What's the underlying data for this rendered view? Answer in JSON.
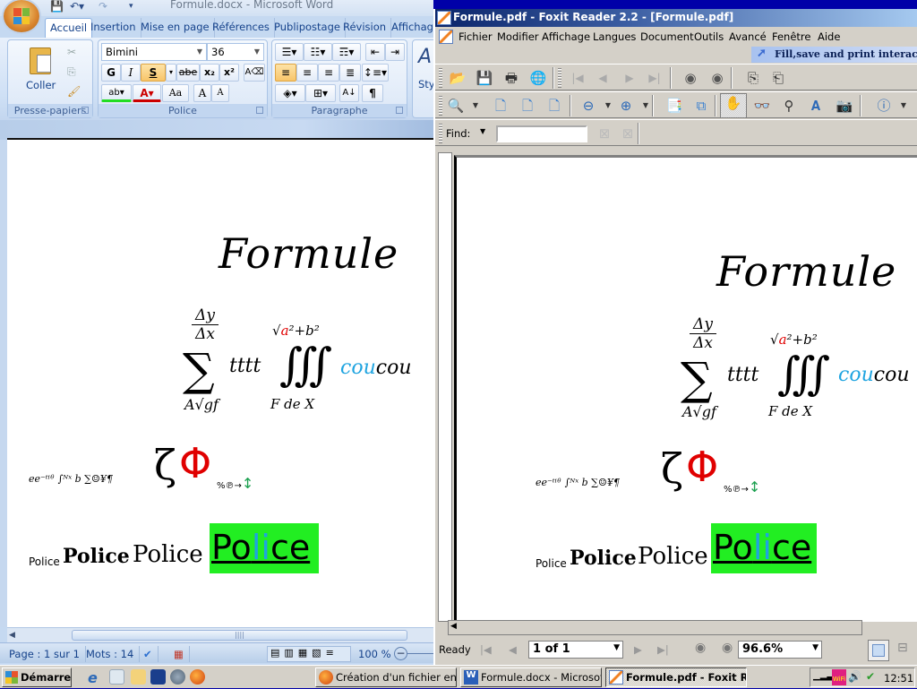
{
  "word": {
    "title": "Formule.docx - Microsoft Word",
    "quick_access": {
      "save": "save-icon",
      "undo": "undo-icon",
      "redo": "redo-icon",
      "customize": "customize-icon"
    },
    "tabs": [
      "Accueil",
      "Insertion",
      "Mise en page",
      "Références",
      "Publipostage",
      "Révision",
      "Affichag"
    ],
    "active_tab": "Accueil",
    "groups": {
      "clipboard": {
        "label": "Presse-papiers",
        "paste": "Coller"
      },
      "font": {
        "label": "Police",
        "font_name": "Bimini",
        "font_size": "36",
        "bold": "G",
        "italic": "I",
        "underline": "S",
        "strike": "abe",
        "subscript": "x₂",
        "superscript": "x²",
        "case": "Aa",
        "grow": "A",
        "shrink": "A"
      },
      "paragraph": {
        "label": "Paragraphe",
        "pilcrow": "¶"
      },
      "styles": {
        "label": "Sty"
      }
    },
    "status": {
      "page": "Page : 1 sur 1",
      "words": "Mots : 14",
      "zoom": "100 %"
    }
  },
  "document": {
    "title": "Formule",
    "fraction_num": "Δy",
    "fraction_den": "Δx",
    "sum": "∑",
    "term": "tttt",
    "sum_lower": "A√gf",
    "integral": "∭",
    "int_upper_a": "a",
    "int_upper_rest": "²+b²",
    "int_lower": "F de X",
    "coucou_blue": "cou",
    "coucou_black": "cou",
    "line2_small": "ee⁻ᵗⁱᶿ ∫ᴺˣ b  ∑☺¥¶",
    "zeta": "ζ",
    "phi": "Φ",
    "line2_tail": "%℗→",
    "arrow_green": "↕",
    "police_1": "Police",
    "police_2": "Police",
    "police_3": "Police",
    "police_4a": "Po",
    "police_4b": "li",
    "police_4c": "ce",
    "colors": {
      "red": "#e00000",
      "blue": "#1fa4e0",
      "green": "#1ca050",
      "highlight": "#22ee22"
    }
  },
  "foxit": {
    "title": "Formule.pdf - Foxit Reader 2.2 - [Formule.pdf]",
    "menu": [
      "Fichier",
      "Modifier",
      "Affichage",
      "Langues",
      "Document",
      "Outils",
      "Avancé",
      "Fenêtre",
      "Aide"
    ],
    "ad": "Fill,save and print interactive f",
    "find_label": "Find:",
    "find_value": "",
    "status": {
      "ready": "Ready",
      "page": "1 of 1",
      "zoom": "96.6%"
    }
  },
  "taskbar": {
    "start": "Démarrer",
    "tasks": [
      "Création d'un fichier en f...",
      "Formule.docx - Microsoft...",
      "Formule.pdf - Foxit R..."
    ],
    "clock": "12:51"
  }
}
